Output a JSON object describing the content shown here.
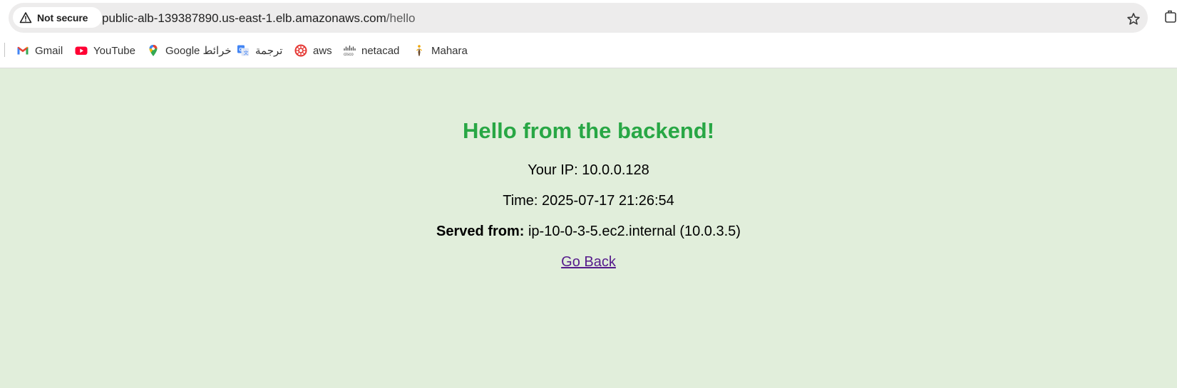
{
  "browser": {
    "security_label": "Not secure",
    "url_host": "public-alb-139387890.us-east-1.elb.amazonaws.com",
    "url_path": "/hello"
  },
  "bookmarks": [
    {
      "label": "Gmail",
      "icon": "gmail-icon"
    },
    {
      "label": "YouTube",
      "icon": "youtube-icon"
    },
    {
      "label": "Google خرائط",
      "icon": "google-maps-icon"
    },
    {
      "label": "ترجمة",
      "icon": "google-translate-icon"
    },
    {
      "label": "aws",
      "icon": "aws-icon"
    },
    {
      "label": "netacad",
      "icon": "cisco-icon"
    },
    {
      "label": "Mahara",
      "icon": "mahara-icon"
    }
  ],
  "page": {
    "heading": "Hello from the backend!",
    "ip_label": "Your IP:",
    "ip_value": "10.0.0.128",
    "time_label": "Time:",
    "time_value": "2025-07-17 21:26:54",
    "served_label": "Served from:",
    "served_value": "ip-10-0-3-5.ec2.internal (10.0.3.5)",
    "back_link": "Go Back"
  },
  "colors": {
    "page_background": "#e1eedb",
    "heading": "#28a745",
    "link": "#551a8b"
  }
}
